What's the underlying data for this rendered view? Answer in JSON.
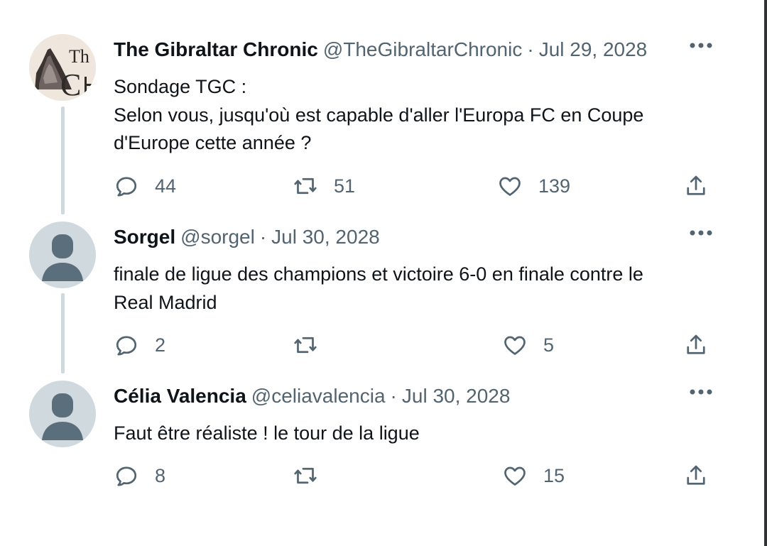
{
  "colors": {
    "text_primary": "#0f1419",
    "text_secondary": "#536471",
    "avatar_default": "#cfd9de",
    "avatar_silhouette": "#5b6e7b",
    "thread_line": "#cfd9de"
  },
  "tweets": [
    {
      "author": {
        "name": "The Gibraltar Chronic",
        "handle": "@TheGibraltarChronic",
        "avatar": "gibraltar-chronicle-logo"
      },
      "date": "Jul 29, 2028",
      "text_lines": [
        "Sondage TGC :",
        "Selon vous, jusqu'où est capable d'aller l'Europa FC en Coupe",
        "d'Europe cette année ?"
      ],
      "stats": {
        "replies": "44",
        "retweets": "51",
        "likes": "139"
      }
    },
    {
      "author": {
        "name": "Sorgel",
        "handle": "@sorgel",
        "avatar": "default-profile-icon"
      },
      "date": "Jul 30, 2028",
      "text_lines": [
        "finale de ligue des champions et victoire 6-0 en finale contre le",
        "Real Madrid"
      ],
      "stats": {
        "replies": "2",
        "retweets": "",
        "likes": "5"
      }
    },
    {
      "author": {
        "name": "Célia Valencia",
        "handle": "@celiavalencia",
        "avatar": "default-profile-icon"
      },
      "date": "Jul 30, 2028",
      "text_lines": [
        "Faut être réaliste ! le tour de la ligue"
      ],
      "stats": {
        "replies": "8",
        "retweets": "",
        "likes": "15"
      }
    }
  ],
  "separator": "·",
  "icons": {
    "more": "more-options-icon",
    "reply": "reply-icon",
    "retweet": "retweet-icon",
    "like": "like-icon",
    "share": "share-icon"
  }
}
